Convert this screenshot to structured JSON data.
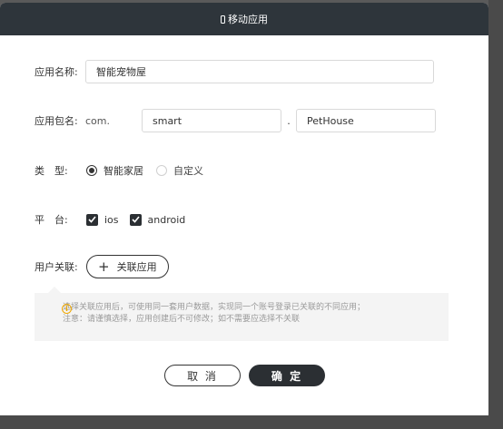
{
  "modal": {
    "title": "移动应用"
  },
  "form": {
    "app_name_label": "应用名称:",
    "app_name_value": "智能宠物屋",
    "package_label": "应用包名:",
    "package_prefix": "com.",
    "package_part1": "smart",
    "package_dot": ".",
    "package_part2": "PetHouse",
    "type_label": "类　型:",
    "type_options": [
      {
        "label": "智能家居",
        "selected": true
      },
      {
        "label": "自定义",
        "selected": false
      }
    ],
    "platform_label": "平　台:",
    "platforms": [
      {
        "label": "ios",
        "checked": true
      },
      {
        "label": "android",
        "checked": true
      }
    ],
    "user_link_label": "用户关联:",
    "link_button_label": "关联应用"
  },
  "tip": {
    "line1": "选择关联应用后，可使用同一套用户数据，实现同一个账号登录已关联的不同应用；",
    "line2": "注意：请谨慎选择，应用创建后不可修改；如不需要应选择不关联"
  },
  "footer": {
    "cancel_label": "取 消",
    "confirm_label": "确 定"
  },
  "colors": {
    "header_bg": "#2e353b",
    "primary": "#2b2f33",
    "warning": "#f0a800"
  },
  "icons": [
    "phone-icon",
    "radio-icon",
    "checkbox-icon",
    "plus-icon",
    "info-icon"
  ]
}
